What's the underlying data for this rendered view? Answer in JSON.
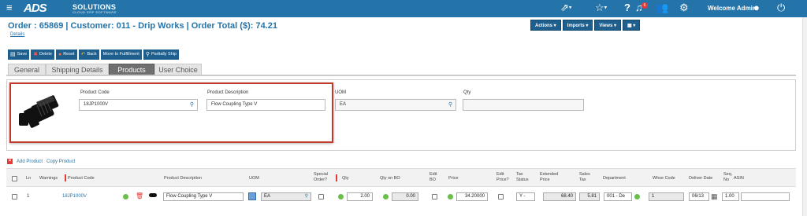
{
  "topbar": {
    "logo_mark": "ADS",
    "logo_name": "SOLUTIONS",
    "logo_sub": "CLOUD ERP SOFTWARE",
    "notification_count": "6",
    "welcome": "Welcome Admin"
  },
  "page": {
    "title": "Order : 65869 | Customer: 011 - Drip Works | Order Total ($): 74.21",
    "details_link": "Details"
  },
  "right_buttons": [
    "Actions ▾",
    "Imports ▾",
    "Views ▾",
    "▦ ▾"
  ],
  "toolbar": {
    "save": "Save",
    "delete": "Delete",
    "reset": "Reset",
    "back": "Back",
    "move": "Move to Fulfillment",
    "ship": "Partially Ship"
  },
  "tabs": [
    "General",
    "Shipping Details",
    "Products",
    "User Choice"
  ],
  "form": {
    "product_code_label": "Product Code",
    "product_code_value": "18JP1000V",
    "product_desc_label": "Product Description",
    "product_desc_value": "Flow Coupling Type V",
    "uom_label": "UOM",
    "uom_value": "EA",
    "qty_label": "Qty",
    "qty_value": ""
  },
  "links": {
    "add_product": "Add Product",
    "copy_product": "Copy Product"
  },
  "table": {
    "headers": {
      "ln": "Ln",
      "warnings": "Warnings",
      "product_code": "Product Code",
      "product_description": "Product Description",
      "uom": "UOM",
      "special_order_1": "Special",
      "special_order_2": "Order?",
      "qty": "Qty",
      "qty_on_bo": "Qty on BO",
      "edit_bo_1": "Edit",
      "edit_bo_2": "BO",
      "price": "Price",
      "edit_price_1": "Edit",
      "edit_price_2": "Price?",
      "tax_status_1": "Tax",
      "tax_status_2": "Status",
      "extended_price_1": "Extended",
      "extended_price_2": "Price",
      "sales_tax_1": "Sales",
      "sales_tax_2": "Tax",
      "department": "Department",
      "whse_code": "Whse Code",
      "deliver_date": "Deliver Date",
      "seq_no_1": "Seq.",
      "seq_no_2": "No",
      "asin": "ASIN"
    },
    "row": {
      "ln": "1",
      "product_code": "18JP1000V",
      "product_description": "Flow Coupling Type V",
      "uom": "EA",
      "qty": "2.00",
      "qty_on_bo": "0.00",
      "price": "34.20000",
      "tax_status": "Y -",
      "extended_price": "68.40",
      "sales_tax": "5.81",
      "department": "001 - De",
      "whse_code": "1",
      "deliver_date": "06/13",
      "seq_no": "1.00",
      "asin": ""
    }
  },
  "colors": {
    "topbar": "#2574a9",
    "button": "#1e5f8e",
    "highlight": "#c0392b",
    "active_tab": "#6f6f6f"
  }
}
